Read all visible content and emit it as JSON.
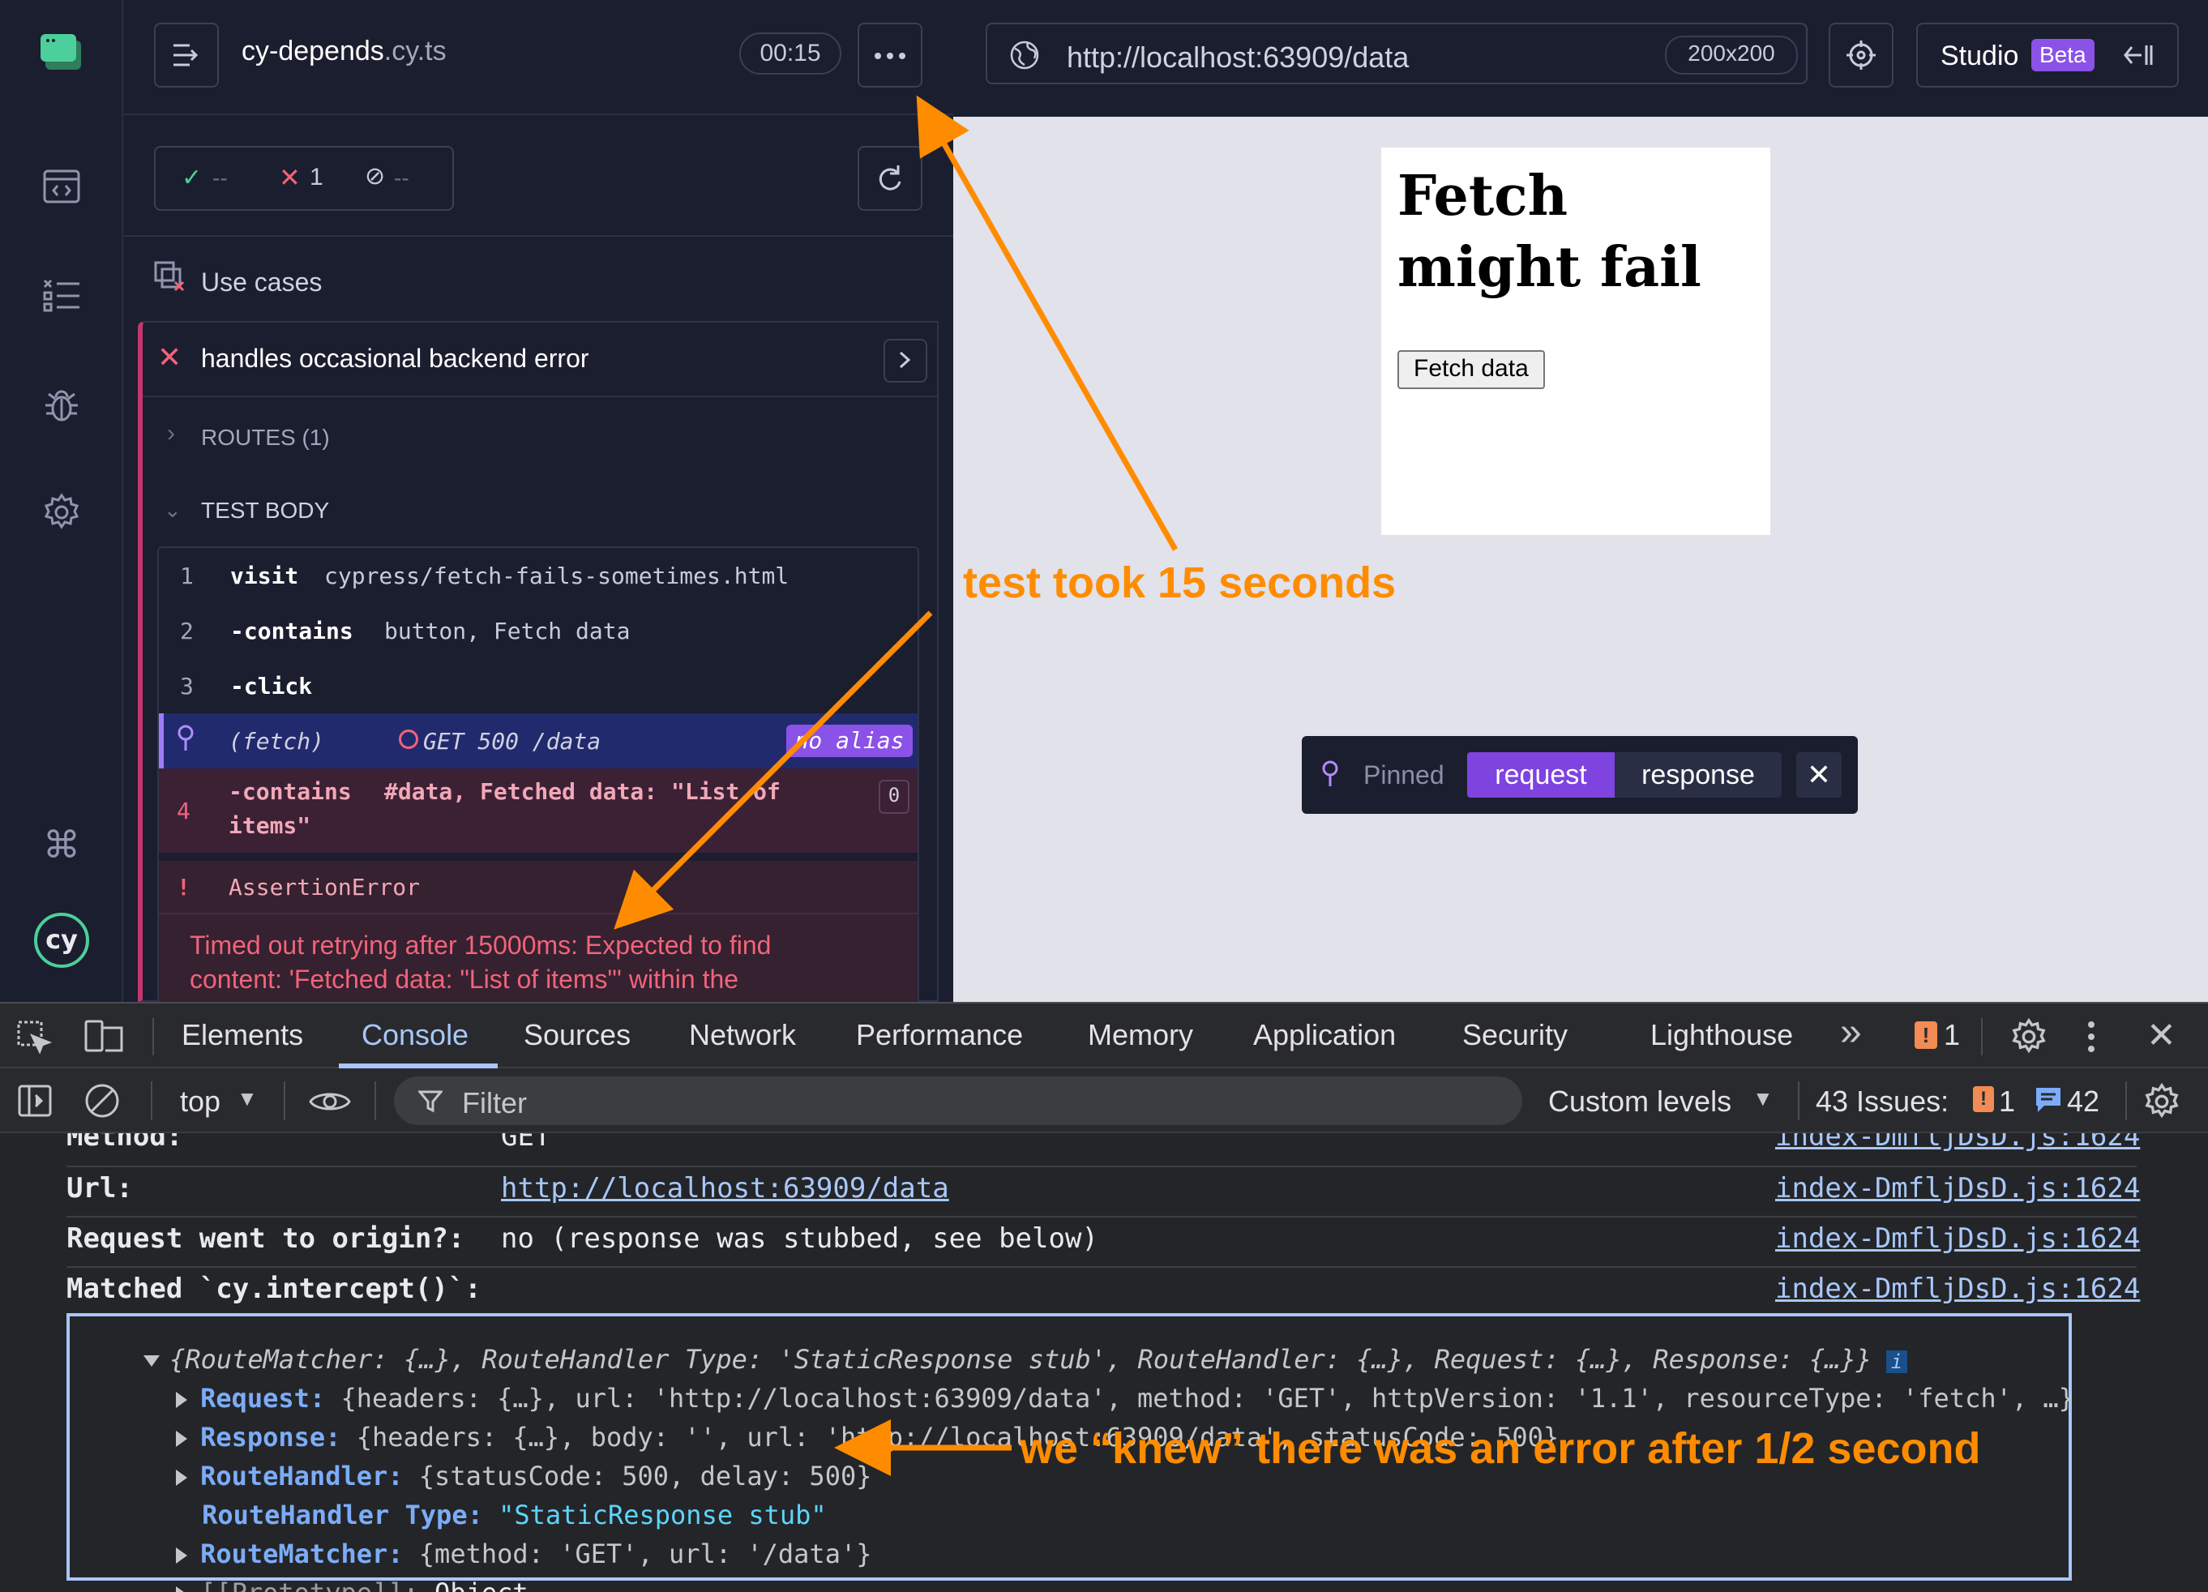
{
  "runner": {
    "spec_name": "cy-depends",
    "spec_ext": ".cy.ts",
    "duration": "00:15",
    "stats": {
      "passed": "--",
      "failed": "1",
      "pending": "--"
    },
    "suite_title": "Use cases",
    "test_title": "handles occasional backend error",
    "routes_label": "ROUTES (1)",
    "body_label": "TEST BODY",
    "commands": [
      {
        "num": "1",
        "name": "visit",
        "msg": "cypress/fetch-fails-sometimes.html"
      },
      {
        "num": "2",
        "name": "-contains",
        "msg": "button, Fetch data"
      },
      {
        "num": "3",
        "name": "-click",
        "msg": ""
      },
      {
        "num": "",
        "name": "(fetch)",
        "msg": "GET 500 /data",
        "badge": "no alias"
      },
      {
        "num": "4",
        "name": "-contains",
        "msg": "#data, Fetched data: \"List of",
        "msg2": "items\"",
        "count": "0"
      }
    ],
    "error_name": "AssertionError",
    "error_msg_1": "Timed out retrying after 15000ms: Expected to find",
    "error_msg_2": "content: 'Fetched data: \"List of items\"' within the"
  },
  "browser": {
    "url": "http://localhost:63909/data",
    "viewport": "200x200",
    "studio": "Studio",
    "beta": "Beta"
  },
  "page": {
    "heading": "Fetch might fail",
    "button": "Fetch data"
  },
  "pinned": {
    "label": "Pinned",
    "request": "request",
    "response": "response"
  },
  "devtools": {
    "tabs": [
      "Elements",
      "Console",
      "Sources",
      "Network",
      "Performance",
      "Memory",
      "Application",
      "Security",
      "Lighthouse"
    ],
    "more": "»",
    "error_count": "1",
    "context": "top",
    "filter_placeholder": "Filter",
    "levels": "Custom levels",
    "issues_label": "43 Issues:",
    "issues_errors": "1",
    "issues_info": "42"
  },
  "console": {
    "source": "index-DmfljDsD.js:1624",
    "method_label": "Method:",
    "method_value": "GET",
    "url_label": "Url:",
    "url_value": "http://localhost:63909/data",
    "origin_label": "Request went to origin?:",
    "origin_value": "no (response was stubbed, see below)",
    "matched_label": "Matched `cy.intercept()`:",
    "summary": "{RouteMatcher: {…}, RouteHandler Type: 'StaticResponse stub', RouteHandler: {…}, Request: {…}, Response: {…}}",
    "request_line": "{headers: {…}, url: 'http://localhost:63909/data', method: 'GET', httpVersion: '1.1', resourceType: 'fetch', …}",
    "response_line": "{headers: {…}, body: '', url: 'http://localhost:63909/data', statusCode: 500}",
    "handler_line": "{statusCode: 500, delay: 500}",
    "handler_type_value": "\"StaticResponse stub\"",
    "matcher_line": "{method: 'GET', url: '/data'}",
    "prototype_value": "Object",
    "keys": {
      "request": "Request",
      "response": "Response",
      "handler": "RouteHandler",
      "handler_type": "RouteHandler Type",
      "matcher": "RouteMatcher",
      "prototype": "[[Prototype]]"
    }
  },
  "annotations": {
    "took": "test took 15 seconds",
    "knew": "we “knew” there was an error after 1/2 second"
  }
}
